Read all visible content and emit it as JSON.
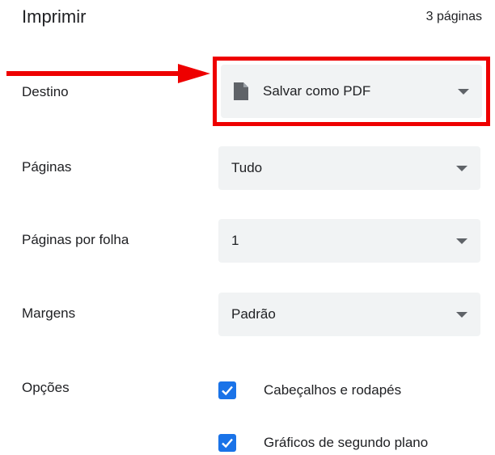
{
  "header": {
    "title": "Imprimir",
    "page_count": "3 páginas"
  },
  "settings": {
    "destination": {
      "label": "Destino",
      "value": "Salvar como PDF",
      "icon": "document-icon"
    },
    "pages": {
      "label": "Páginas",
      "value": "Tudo"
    },
    "pages_per_sheet": {
      "label": "Páginas por folha",
      "value": "1"
    },
    "margins": {
      "label": "Margens",
      "value": "Padrão"
    },
    "options": {
      "label": "Opções",
      "items": [
        {
          "label": "Cabeçalhos e rodapés",
          "checked": true
        },
        {
          "label": "Gráficos de segundo plano",
          "checked": true
        }
      ]
    }
  },
  "annotation": {
    "highlight_color": "#ee0000",
    "arrow_color": "#ee0000"
  },
  "colors": {
    "select_bg": "#f1f3f4",
    "checkbox_accent": "#1a73e8",
    "text": "#202124",
    "caret": "#5f6368"
  }
}
